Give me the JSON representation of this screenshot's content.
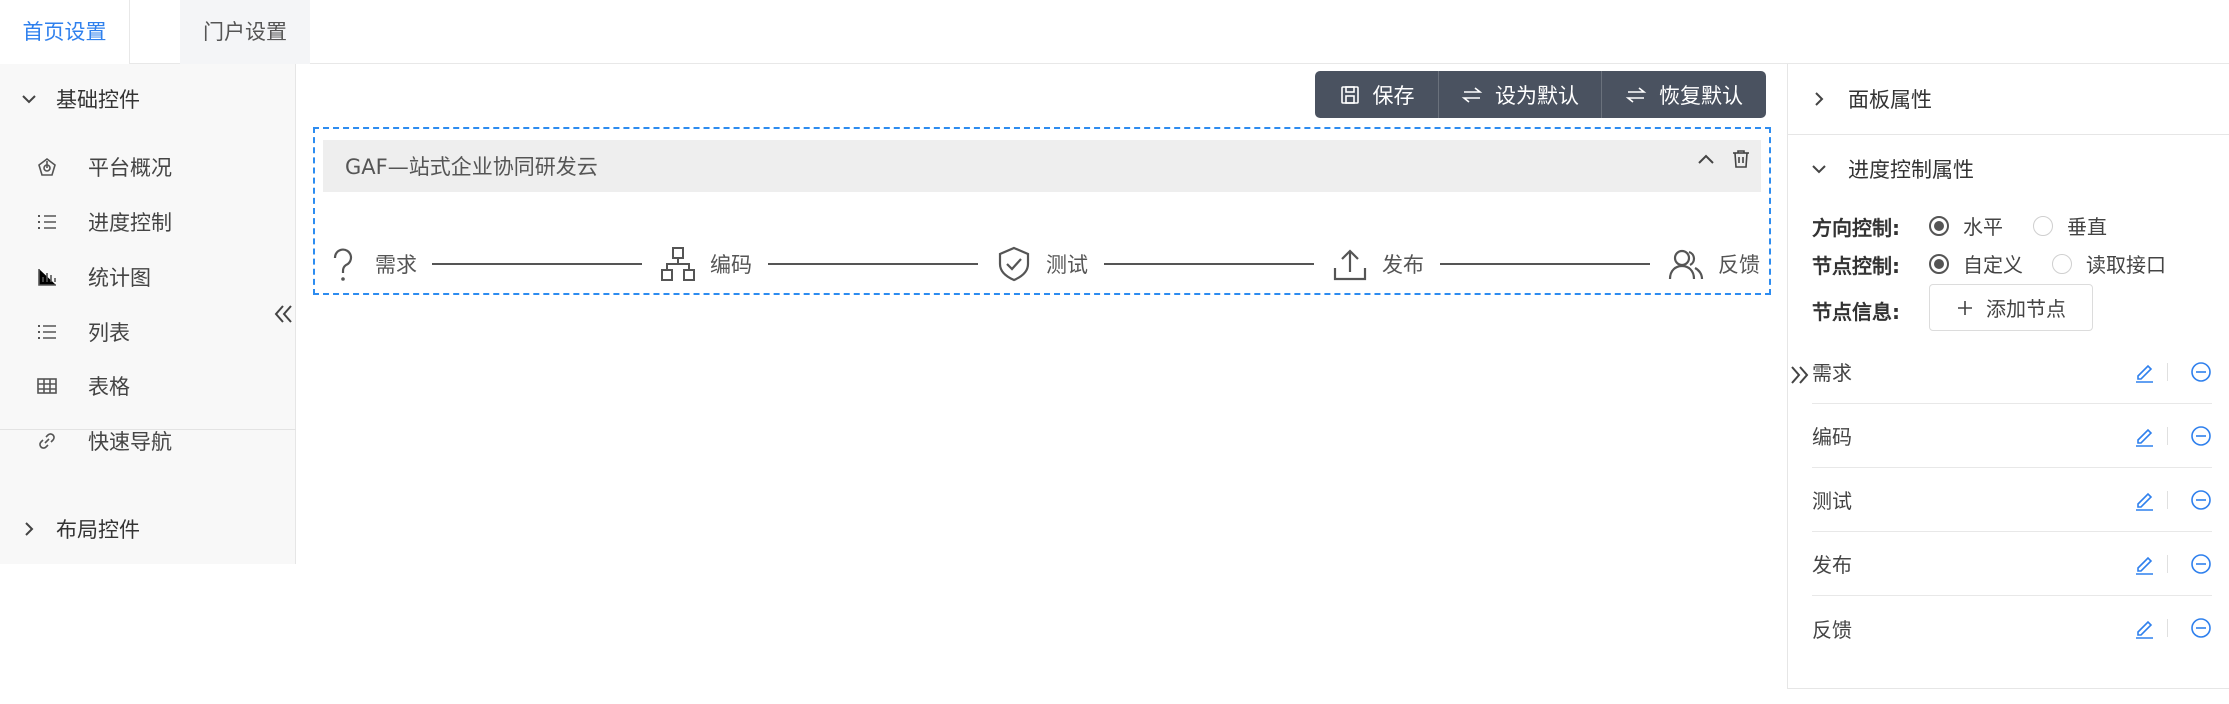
{
  "tabs": [
    {
      "label": "首页设置",
      "active": true
    },
    {
      "label": "门户设置",
      "active": false
    }
  ],
  "left_panel": {
    "basic_section": {
      "label": "基础控件",
      "expanded": true
    },
    "items": [
      {
        "label": "平台概况",
        "icon": "dashboard-icon"
      },
      {
        "label": "进度控制",
        "icon": "ordered-list-icon"
      },
      {
        "label": "统计图",
        "icon": "bar-chart-icon"
      },
      {
        "label": "列表",
        "icon": "list-icon"
      },
      {
        "label": "表格",
        "icon": "table-icon"
      },
      {
        "label": "快速导航",
        "icon": "link-icon"
      }
    ],
    "layout_section": {
      "label": "布局控件",
      "expanded": false
    }
  },
  "toolbar": {
    "save_label": "保存",
    "set_default_label": "设为默认",
    "restore_default_label": "恢复默认"
  },
  "canvas": {
    "card_title": "GAF—站式企业协同研发云",
    "nodes": [
      {
        "label": "需求",
        "icon": "question-icon"
      },
      {
        "label": "编码",
        "icon": "hierarchy-icon"
      },
      {
        "label": "测试",
        "icon": "shield-check-icon"
      },
      {
        "label": "发布",
        "icon": "upload-icon"
      },
      {
        "label": "反馈",
        "icon": "users-icon"
      }
    ]
  },
  "right_panel": {
    "panel_props_label": "面板属性",
    "progress_props_label": "进度控制属性",
    "direction": {
      "label": "方向控制:",
      "options": [
        "水平",
        "垂直"
      ],
      "selected": "水平"
    },
    "node_control": {
      "label": "节点控制:",
      "options": [
        "自定义",
        "读取接口"
      ],
      "selected": "自定义"
    },
    "node_info": {
      "label": "节点信息:",
      "add_label": "添加节点"
    },
    "node_list": [
      "需求",
      "编码",
      "测试",
      "发布",
      "反馈"
    ]
  },
  "colors": {
    "accent": "#2f80ed",
    "toolbar_bg": "#4a5260",
    "dashed_border": "#2d8cf0"
  }
}
